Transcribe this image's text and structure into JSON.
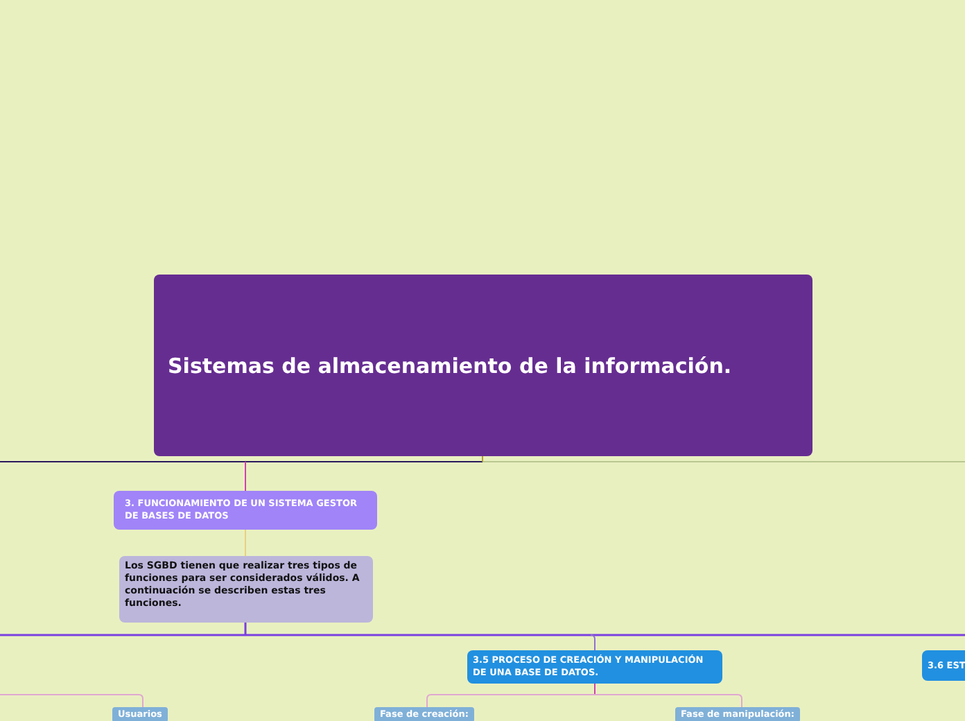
{
  "central_topic": {
    "title": "Sistemas de almacenamiento de la información."
  },
  "topics": [
    {
      "kind": "main",
      "text": "3. FUNCIONAMIENTO DE UN SISTEMA GESTOR DE BASES DE DATOS"
    },
    {
      "kind": "note",
      "text": "Los SGBD tienen que realizar tres tipos de funciones para ser considerados válidos. A continuación se describen estas tres funciones."
    },
    {
      "kind": "section",
      "text": "3.5 PROCESO DE CREACIÓN Y MANIPULACIÓN DE UNA BASE DE DATOS."
    },
    {
      "kind": "section",
      "text": "3.6 EST"
    },
    {
      "kind": "sub",
      "text": "Usuarios"
    },
    {
      "kind": "sub",
      "text": "Fase de creación:"
    },
    {
      "kind": "sub",
      "text": "Fase de manipulación:"
    }
  ]
}
